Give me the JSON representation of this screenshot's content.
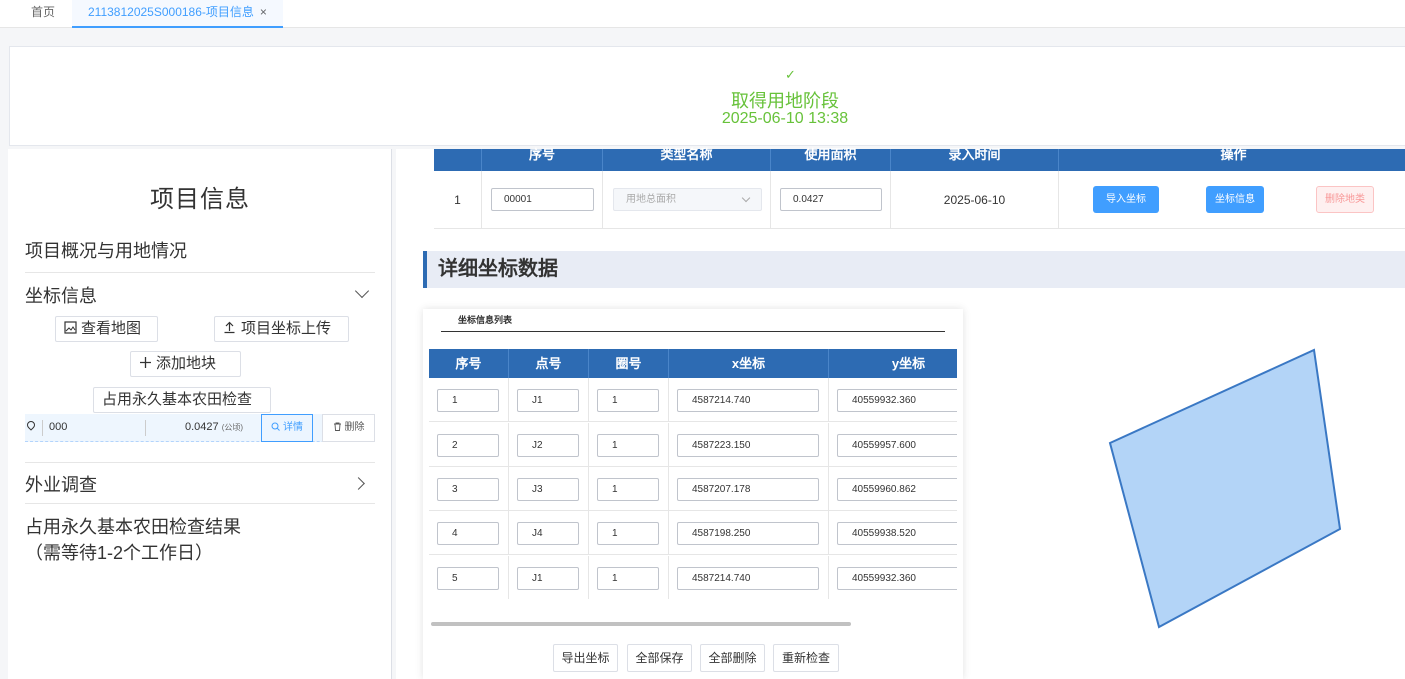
{
  "tabs": {
    "home_label": "首页",
    "active_label": "2113812025S000186-项目信息",
    "close_glyph": "×"
  },
  "banner": {
    "check_glyph": "✓",
    "stage": "取得用地阶段",
    "time": "2025-06-10 13:38"
  },
  "left": {
    "title": "项目信息",
    "section_overview": "项目概况与用地情况",
    "section_coords": "坐标信息",
    "btn_view_map": "查看地图",
    "btn_upload_coords": "项目坐标上传",
    "btn_add_parcel": "添加地块",
    "btn_farmland_check": "占用永久基本农田检查",
    "parcel": {
      "name": "000",
      "area": "0.0427",
      "unit": "(公顷)",
      "detail_label": "详情",
      "delete_label": "删除"
    },
    "section_field": "外业调查",
    "result_line1": "占用永久基本农田检查结果",
    "result_line2": "（需等待1-2个工作日）"
  },
  "land_table": {
    "headers": [
      "序号",
      "类型名称",
      "使用面积",
      "录入时间",
      "操作"
    ],
    "row": {
      "index": "1",
      "code": "00001",
      "type_placeholder": "用地总面积",
      "area": "0.0427",
      "date": "2025-06-10",
      "btn_import": "导入坐标",
      "btn_coord_info": "坐标信息",
      "btn_delete": "删除地类"
    }
  },
  "detail": {
    "heading": "详细坐标数据",
    "list_title": "坐标信息列表",
    "headers": [
      "序号",
      "点号",
      "圈号",
      "x坐标",
      "y坐标"
    ],
    "rows": [
      {
        "seq": "1",
        "point": "J1",
        "ring": "1",
        "x": "4587214.740",
        "y": "40559932.360"
      },
      {
        "seq": "2",
        "point": "J2",
        "ring": "1",
        "x": "4587223.150",
        "y": "40559957.600"
      },
      {
        "seq": "3",
        "point": "J3",
        "ring": "1",
        "x": "4587207.178",
        "y": "40559960.862"
      },
      {
        "seq": "4",
        "point": "J4",
        "ring": "1",
        "x": "4587198.250",
        "y": "40559938.520"
      },
      {
        "seq": "5",
        "point": "J1",
        "ring": "1",
        "x": "4587214.740",
        "y": "40559932.360"
      }
    ],
    "btn_export": "导出坐标",
    "btn_save_all": "全部保存",
    "btn_delete_all": "全部删除",
    "btn_recheck": "重新检查"
  },
  "colors": {
    "accent": "#409eff",
    "header_blue": "#2d6bb3",
    "success": "#67c23a",
    "polygon_fill": "#b3d4f7",
    "polygon_stroke": "#3a78c4"
  }
}
